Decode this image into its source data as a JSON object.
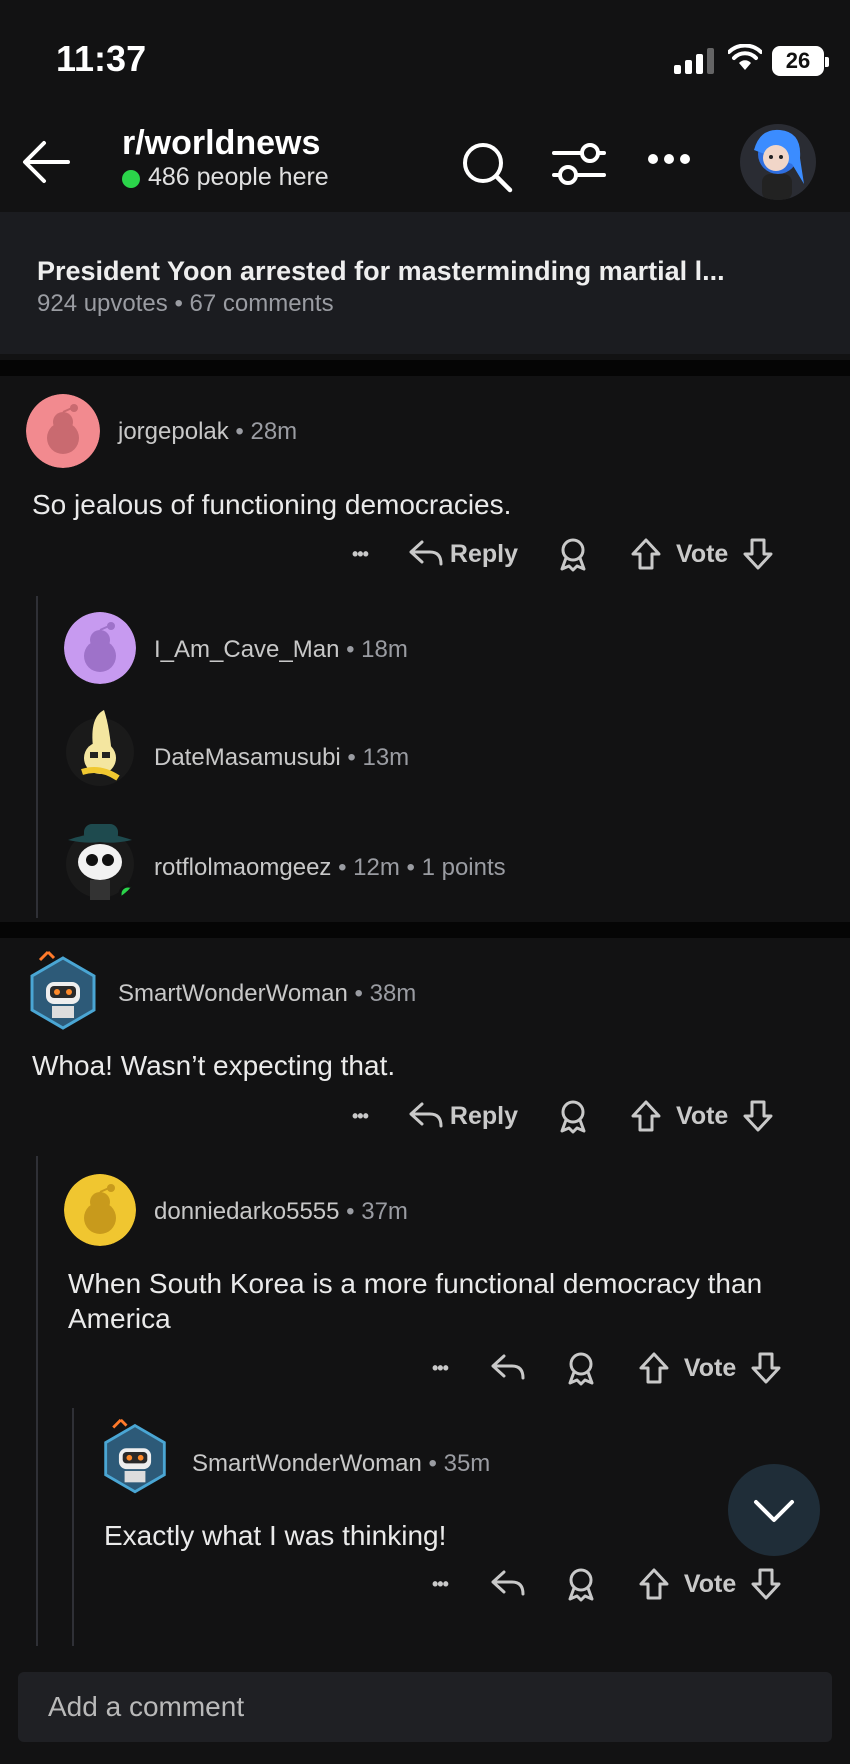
{
  "status_bar": {
    "time": "11:37",
    "battery": "26"
  },
  "header": {
    "subreddit": "r/worldnews",
    "online": "486 people here",
    "icons": [
      "back-arrow-icon",
      "search-icon",
      "filter-icon",
      "more-icon",
      "user-avatar"
    ]
  },
  "post": {
    "title": "President Yoon arrested for masterminding martial l...",
    "meta": "924 upvotes • 67 comments"
  },
  "actions": {
    "reply_label": "Reply",
    "vote_label": "Vote",
    "more": "•••"
  },
  "comments": [
    {
      "user": "jorgepolak",
      "meta": " • 28m",
      "text": "So jealous of functioning democracies."
    },
    {
      "user": "I_Am_Cave_Man",
      "meta": " • 18m"
    },
    {
      "user": "DateMasamusubi",
      "meta": " • 13m"
    },
    {
      "user": "rotflolmaomgeez",
      "meta": " • 12m • 1 points"
    },
    {
      "user": "SmartWonderWoman",
      "meta": " • 38m",
      "text": "Whoa! Wasn’t expecting that."
    },
    {
      "user": "donniedarko5555",
      "meta": " • 37m",
      "text": "When South Korea is a more functional democracy than America"
    },
    {
      "user": "SmartWonderWoman",
      "meta": " • 35m",
      "text": "Exactly what I was thinking!"
    }
  ],
  "composer": {
    "placeholder": "Add a comment"
  },
  "colors": {
    "background": "#121213",
    "online": "#2bd44a",
    "accent_fab": "#1f2d38"
  }
}
